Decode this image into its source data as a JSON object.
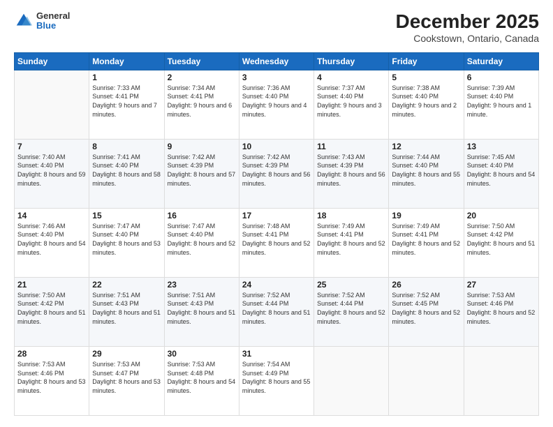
{
  "logo": {
    "general": "General",
    "blue": "Blue"
  },
  "header": {
    "title": "December 2025",
    "subtitle": "Cookstown, Ontario, Canada"
  },
  "weekdays": [
    "Sunday",
    "Monday",
    "Tuesday",
    "Wednesday",
    "Thursday",
    "Friday",
    "Saturday"
  ],
  "weeks": [
    [
      {
        "day": "",
        "sunrise": "",
        "sunset": "",
        "daylight": ""
      },
      {
        "day": "1",
        "sunrise": "Sunrise: 7:33 AM",
        "sunset": "Sunset: 4:41 PM",
        "daylight": "Daylight: 9 hours and 7 minutes."
      },
      {
        "day": "2",
        "sunrise": "Sunrise: 7:34 AM",
        "sunset": "Sunset: 4:41 PM",
        "daylight": "Daylight: 9 hours and 6 minutes."
      },
      {
        "day": "3",
        "sunrise": "Sunrise: 7:36 AM",
        "sunset": "Sunset: 4:40 PM",
        "daylight": "Daylight: 9 hours and 4 minutes."
      },
      {
        "day": "4",
        "sunrise": "Sunrise: 7:37 AM",
        "sunset": "Sunset: 4:40 PM",
        "daylight": "Daylight: 9 hours and 3 minutes."
      },
      {
        "day": "5",
        "sunrise": "Sunrise: 7:38 AM",
        "sunset": "Sunset: 4:40 PM",
        "daylight": "Daylight: 9 hours and 2 minutes."
      },
      {
        "day": "6",
        "sunrise": "Sunrise: 7:39 AM",
        "sunset": "Sunset: 4:40 PM",
        "daylight": "Daylight: 9 hours and 1 minute."
      }
    ],
    [
      {
        "day": "7",
        "sunrise": "Sunrise: 7:40 AM",
        "sunset": "Sunset: 4:40 PM",
        "daylight": "Daylight: 8 hours and 59 minutes."
      },
      {
        "day": "8",
        "sunrise": "Sunrise: 7:41 AM",
        "sunset": "Sunset: 4:40 PM",
        "daylight": "Daylight: 8 hours and 58 minutes."
      },
      {
        "day": "9",
        "sunrise": "Sunrise: 7:42 AM",
        "sunset": "Sunset: 4:39 PM",
        "daylight": "Daylight: 8 hours and 57 minutes."
      },
      {
        "day": "10",
        "sunrise": "Sunrise: 7:42 AM",
        "sunset": "Sunset: 4:39 PM",
        "daylight": "Daylight: 8 hours and 56 minutes."
      },
      {
        "day": "11",
        "sunrise": "Sunrise: 7:43 AM",
        "sunset": "Sunset: 4:39 PM",
        "daylight": "Daylight: 8 hours and 56 minutes."
      },
      {
        "day": "12",
        "sunrise": "Sunrise: 7:44 AM",
        "sunset": "Sunset: 4:40 PM",
        "daylight": "Daylight: 8 hours and 55 minutes."
      },
      {
        "day": "13",
        "sunrise": "Sunrise: 7:45 AM",
        "sunset": "Sunset: 4:40 PM",
        "daylight": "Daylight: 8 hours and 54 minutes."
      }
    ],
    [
      {
        "day": "14",
        "sunrise": "Sunrise: 7:46 AM",
        "sunset": "Sunset: 4:40 PM",
        "daylight": "Daylight: 8 hours and 54 minutes."
      },
      {
        "day": "15",
        "sunrise": "Sunrise: 7:47 AM",
        "sunset": "Sunset: 4:40 PM",
        "daylight": "Daylight: 8 hours and 53 minutes."
      },
      {
        "day": "16",
        "sunrise": "Sunrise: 7:47 AM",
        "sunset": "Sunset: 4:40 PM",
        "daylight": "Daylight: 8 hours and 52 minutes."
      },
      {
        "day": "17",
        "sunrise": "Sunrise: 7:48 AM",
        "sunset": "Sunset: 4:41 PM",
        "daylight": "Daylight: 8 hours and 52 minutes."
      },
      {
        "day": "18",
        "sunrise": "Sunrise: 7:49 AM",
        "sunset": "Sunset: 4:41 PM",
        "daylight": "Daylight: 8 hours and 52 minutes."
      },
      {
        "day": "19",
        "sunrise": "Sunrise: 7:49 AM",
        "sunset": "Sunset: 4:41 PM",
        "daylight": "Daylight: 8 hours and 52 minutes."
      },
      {
        "day": "20",
        "sunrise": "Sunrise: 7:50 AM",
        "sunset": "Sunset: 4:42 PM",
        "daylight": "Daylight: 8 hours and 51 minutes."
      }
    ],
    [
      {
        "day": "21",
        "sunrise": "Sunrise: 7:50 AM",
        "sunset": "Sunset: 4:42 PM",
        "daylight": "Daylight: 8 hours and 51 minutes."
      },
      {
        "day": "22",
        "sunrise": "Sunrise: 7:51 AM",
        "sunset": "Sunset: 4:43 PM",
        "daylight": "Daylight: 8 hours and 51 minutes."
      },
      {
        "day": "23",
        "sunrise": "Sunrise: 7:51 AM",
        "sunset": "Sunset: 4:43 PM",
        "daylight": "Daylight: 8 hours and 51 minutes."
      },
      {
        "day": "24",
        "sunrise": "Sunrise: 7:52 AM",
        "sunset": "Sunset: 4:44 PM",
        "daylight": "Daylight: 8 hours and 51 minutes."
      },
      {
        "day": "25",
        "sunrise": "Sunrise: 7:52 AM",
        "sunset": "Sunset: 4:44 PM",
        "daylight": "Daylight: 8 hours and 52 minutes."
      },
      {
        "day": "26",
        "sunrise": "Sunrise: 7:52 AM",
        "sunset": "Sunset: 4:45 PM",
        "daylight": "Daylight: 8 hours and 52 minutes."
      },
      {
        "day": "27",
        "sunrise": "Sunrise: 7:53 AM",
        "sunset": "Sunset: 4:46 PM",
        "daylight": "Daylight: 8 hours and 52 minutes."
      }
    ],
    [
      {
        "day": "28",
        "sunrise": "Sunrise: 7:53 AM",
        "sunset": "Sunset: 4:46 PM",
        "daylight": "Daylight: 8 hours and 53 minutes."
      },
      {
        "day": "29",
        "sunrise": "Sunrise: 7:53 AM",
        "sunset": "Sunset: 4:47 PM",
        "daylight": "Daylight: 8 hours and 53 minutes."
      },
      {
        "day": "30",
        "sunrise": "Sunrise: 7:53 AM",
        "sunset": "Sunset: 4:48 PM",
        "daylight": "Daylight: 8 hours and 54 minutes."
      },
      {
        "day": "31",
        "sunrise": "Sunrise: 7:54 AM",
        "sunset": "Sunset: 4:49 PM",
        "daylight": "Daylight: 8 hours and 55 minutes."
      },
      {
        "day": "",
        "sunrise": "",
        "sunset": "",
        "daylight": ""
      },
      {
        "day": "",
        "sunrise": "",
        "sunset": "",
        "daylight": ""
      },
      {
        "day": "",
        "sunrise": "",
        "sunset": "",
        "daylight": ""
      }
    ]
  ]
}
